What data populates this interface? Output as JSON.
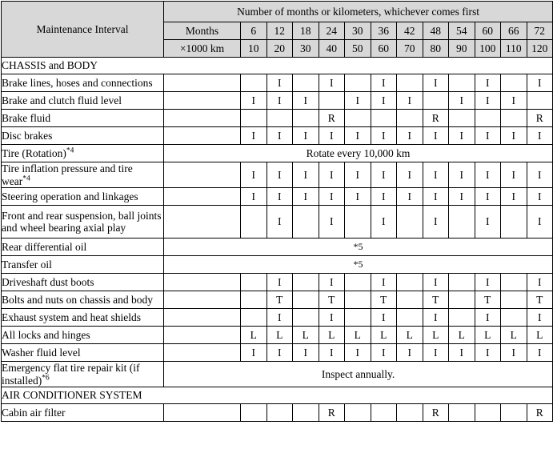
{
  "document": {
    "type": "maintenance-schedule-table"
  },
  "header": {
    "interval_label": "Maintenance Interval",
    "span_title": "Number of months or kilometers, whichever comes first",
    "months_label": "Months",
    "km_label": "×1000 km",
    "months_values": [
      "6",
      "12",
      "18",
      "24",
      "30",
      "36",
      "42",
      "48",
      "54",
      "60",
      "66",
      "72"
    ],
    "km_values": [
      "10",
      "20",
      "30",
      "40",
      "50",
      "60",
      "70",
      "80",
      "90",
      "100",
      "110",
      "120"
    ]
  },
  "colors": {
    "header_background": "#d8d8d8",
    "border": "#000000",
    "text": "#000000",
    "body_background": "#ffffff"
  },
  "legend_marks": {
    "inspect": "I",
    "replace": "R",
    "tighten": "T",
    "lubricate": "L"
  },
  "sections": [
    {
      "title": "CHASSIS and BODY",
      "rows": [
        {
          "label": "Brake lines, hoses and connections",
          "footnote": "",
          "type": "marks",
          "cells": [
            "",
            "I",
            "",
            "I",
            "",
            "I",
            "",
            "I",
            "",
            "I",
            "",
            "I"
          ]
        },
        {
          "label": "Brake and clutch fluid level",
          "footnote": "",
          "type": "marks",
          "cells": [
            "I",
            "I",
            "I",
            "",
            "I",
            "I",
            "I",
            "",
            "I",
            "I",
            "I",
            ""
          ]
        },
        {
          "label": "Brake fluid",
          "footnote": "",
          "type": "marks",
          "cells": [
            "",
            "",
            "",
            "R",
            "",
            "",
            "",
            "R",
            "",
            "",
            "",
            "R"
          ]
        },
        {
          "label": "Disc brakes",
          "footnote": "",
          "type": "marks",
          "cells": [
            "I",
            "I",
            "I",
            "I",
            "I",
            "I",
            "I",
            "I",
            "I",
            "I",
            "I",
            "I"
          ]
        },
        {
          "label": "Tire (Rotation)",
          "footnote": "*4",
          "type": "span",
          "note": "Rotate every 10,000 km"
        },
        {
          "label": "Tire inflation pressure and tire wear",
          "footnote": "*4",
          "type": "marks",
          "cells": [
            "I",
            "I",
            "I",
            "I",
            "I",
            "I",
            "I",
            "I",
            "I",
            "I",
            "I",
            "I"
          ]
        },
        {
          "label": "Steering operation and linkages",
          "footnote": "",
          "type": "marks",
          "cells": [
            "I",
            "I",
            "I",
            "I",
            "I",
            "I",
            "I",
            "I",
            "I",
            "I",
            "I",
            "I"
          ]
        },
        {
          "label": "Front and rear suspension, ball joints and wheel bearing axial play",
          "footnote": "",
          "type": "marks",
          "two_line": true,
          "cells": [
            "",
            "I",
            "",
            "I",
            "",
            "I",
            "",
            "I",
            "",
            "I",
            "",
            "I"
          ]
        },
        {
          "label": "Rear differential oil",
          "footnote": "",
          "type": "span",
          "note": "*5",
          "note_small": true
        },
        {
          "label": "Transfer oil",
          "footnote": "",
          "type": "span",
          "note": "*5",
          "note_small": true
        },
        {
          "label": "Driveshaft dust boots",
          "footnote": "",
          "type": "marks",
          "cells": [
            "",
            "I",
            "",
            "I",
            "",
            "I",
            "",
            "I",
            "",
            "I",
            "",
            "I"
          ]
        },
        {
          "label": "Bolts and nuts on chassis and body",
          "footnote": "",
          "type": "marks",
          "cells": [
            "",
            "T",
            "",
            "T",
            "",
            "T",
            "",
            "T",
            "",
            "T",
            "",
            "T"
          ]
        },
        {
          "label": "Exhaust system and heat shields",
          "footnote": "",
          "type": "marks",
          "cells": [
            "",
            "I",
            "",
            "I",
            "",
            "I",
            "",
            "I",
            "",
            "I",
            "",
            "I"
          ]
        },
        {
          "label": "All locks and hinges",
          "footnote": "",
          "type": "marks",
          "cells": [
            "L",
            "L",
            "L",
            "L",
            "L",
            "L",
            "L",
            "L",
            "L",
            "L",
            "L",
            "L"
          ]
        },
        {
          "label": "Washer fluid level",
          "footnote": "",
          "type": "marks",
          "cells": [
            "I",
            "I",
            "I",
            "I",
            "I",
            "I",
            "I",
            "I",
            "I",
            "I",
            "I",
            "I"
          ]
        },
        {
          "label": "Emergency flat tire repair kit (if installed)",
          "footnote": "*6",
          "type": "span",
          "note": "Inspect annually."
        }
      ]
    },
    {
      "title": "AIR CONDITIONER SYSTEM",
      "rows": [
        {
          "label": "Cabin air filter",
          "footnote": "",
          "type": "marks",
          "cells": [
            "",
            "",
            "",
            "R",
            "",
            "",
            "",
            "R",
            "",
            "",
            "",
            "R"
          ]
        }
      ]
    }
  ]
}
